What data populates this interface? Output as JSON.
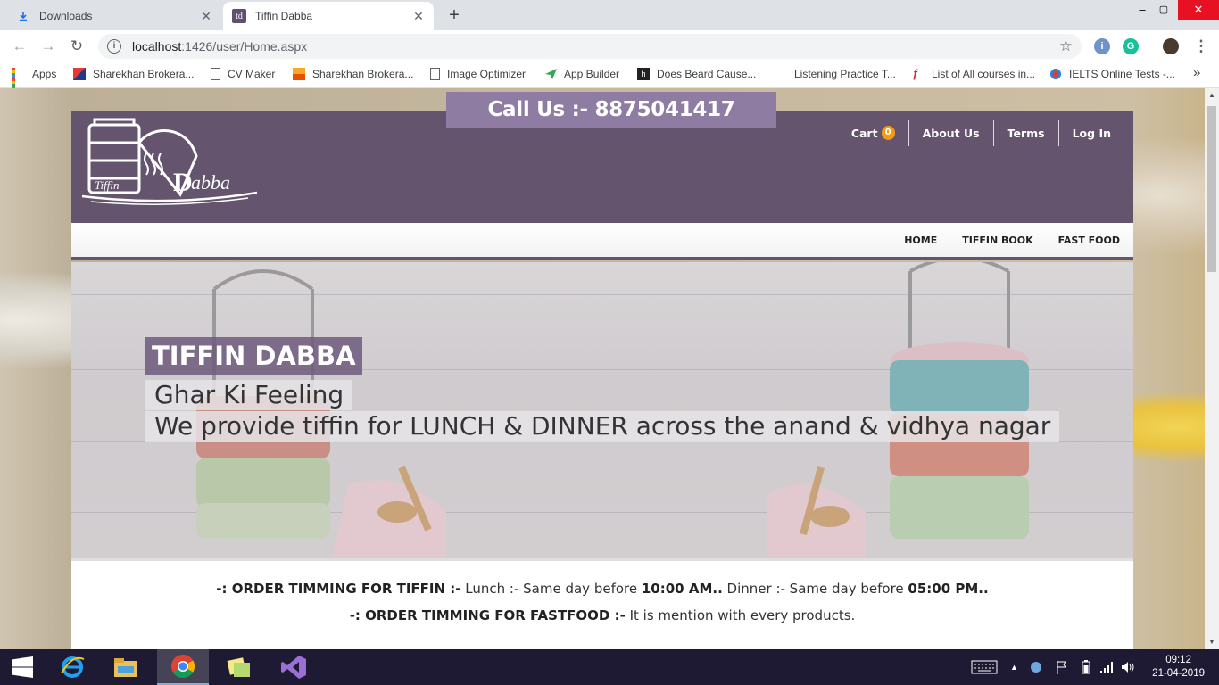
{
  "browser": {
    "tabs": [
      {
        "title": "Downloads",
        "active": false
      },
      {
        "title": "Tiffin Dabba",
        "active": true
      }
    ],
    "tab_favicon_text": "td",
    "address": {
      "host": "localhost",
      "path": ":1426/user/Home.aspx"
    },
    "window_controls": {
      "minimize": "–",
      "maximize": "▢",
      "close": "✕"
    },
    "bookmarks": [
      {
        "label": "Apps",
        "icon": "apps-grid-icon"
      },
      {
        "label": "Sharekhan Brokera...",
        "icon": "sharekhan-icon"
      },
      {
        "label": "CV Maker",
        "icon": "page-icon"
      },
      {
        "label": "Sharekhan Brokera...",
        "icon": "sharekhan-icon"
      },
      {
        "label": "Image Optimizer",
        "icon": "page-icon"
      },
      {
        "label": "App Builder",
        "icon": "paper-plane-icon"
      },
      {
        "label": "Does Beard Cause...",
        "icon": "site-icon"
      },
      {
        "label": "Listening Practice T...",
        "icon": "none"
      },
      {
        "label": "List of All courses in...",
        "icon": "course-icon"
      },
      {
        "label": "IELTS Online Tests -...",
        "icon": "ielts-icon"
      }
    ],
    "bookmarks_overflow": "»"
  },
  "page": {
    "call_us": "Call Us :- 8875041417",
    "logo_text": {
      "tiffin": "Tiffin",
      "dabba": "abba",
      "d": "D"
    },
    "top_nav": {
      "cart_label": "Cart",
      "cart_count": "0",
      "about": "About Us",
      "terms": "Terms",
      "login": "Log In"
    },
    "main_nav": [
      "HOME",
      "TIFFIN BOOK",
      "FAST FOOD"
    ],
    "hero": {
      "title": "TIFFIN DABBA",
      "line1": "Ghar Ki Feeling",
      "line2": "We provide tiffin for LUNCH & DINNER across the anand & vidhya nagar"
    },
    "timing": {
      "tiffin_label": "-: ORDER TIMMING FOR TIFFIN :-",
      "tiffin_lunch": " Lunch :- Same day before ",
      "tiffin_lunch_time": "10:00 AM..",
      "tiffin_dinner": " Dinner :- Same day before ",
      "tiffin_dinner_time": "05:00 PM..",
      "fastfood_label": "-: ORDER TIMMING FOR FASTFOOD :-",
      "fastfood_text": " It is mention with every products."
    }
  },
  "taskbar": {
    "clock_time": "09:12",
    "clock_date": "21-04-2019"
  },
  "colors": {
    "header_purple": "#64546e",
    "callus_purple": "#8e7ca3",
    "cart_badge": "#f39c12",
    "taskbar": "#1f1a33"
  }
}
